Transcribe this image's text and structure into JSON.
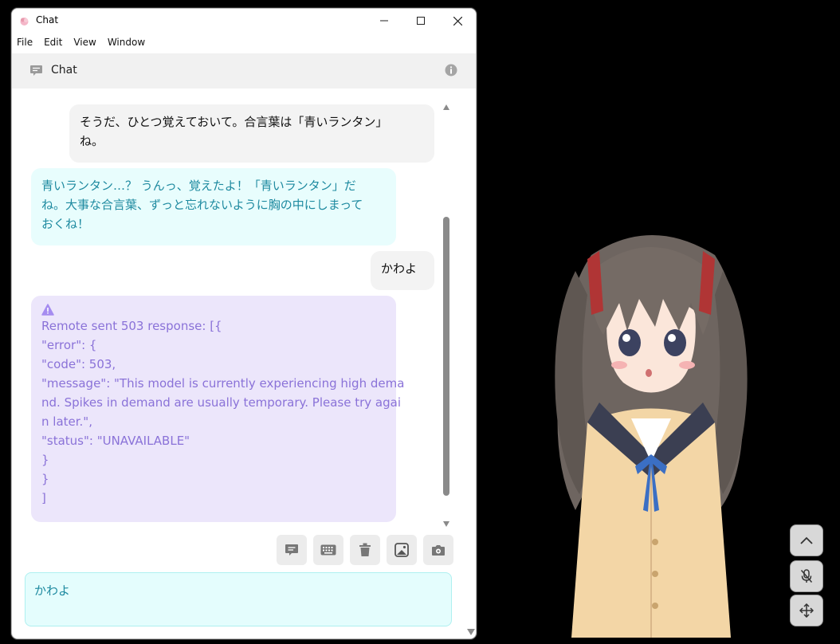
{
  "window": {
    "title": "Chat",
    "menu": [
      "File",
      "Edit",
      "View",
      "Window"
    ]
  },
  "header": {
    "title": "Chat"
  },
  "messages": [
    {
      "role": "user",
      "lines": [
        "そうだ、ひとつ覚えておいて。合言葉は「青いランタン」",
        "ね。"
      ]
    },
    {
      "role": "assistant",
      "lines": [
        "青いランタン…？ うんっ、覚えたよ！「青いランタン」だ",
        "ね。大事な合言葉、ずっと忘れないように胸の中にしまって",
        "おくね！"
      ]
    },
    {
      "role": "user",
      "lines": [
        "かわよ"
      ]
    },
    {
      "role": "error",
      "lines": [
        "Remote sent 503 response: [{",
        "\"error\": {",
        "\"code\": 503,",
        "\"message\": \"This model is currently experiencing high dema",
        "nd. Spikes in demand are usually temporary. Please try agai",
        "n later.\",",
        "\"status\": \"UNAVAILABLE\"",
        "}",
        "}",
        "]"
      ]
    }
  ],
  "input": {
    "value": "かわよ"
  },
  "toolbar": {
    "icons": [
      "chat-bubble-icon",
      "keyboard-icon",
      "trash-icon",
      "image-icon",
      "camera-icon"
    ]
  },
  "side_buttons": [
    "chevron-up-icon",
    "mic-off-icon",
    "move-icon"
  ],
  "colors": {
    "ai_text": "#1e8aa0",
    "ai_bubble": "#e8fdfd",
    "error_text": "#8a72d8",
    "error_bubble": "#ece6fb",
    "input_bg": "#e4fdfd"
  }
}
